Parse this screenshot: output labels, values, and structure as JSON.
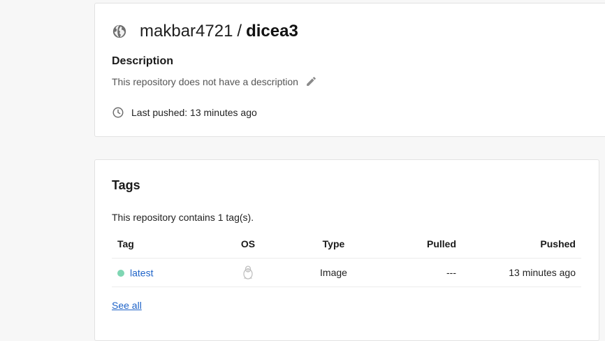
{
  "repo": {
    "owner": "makbar4721",
    "separator": "/",
    "name": "dicea3",
    "visibility_icon": "globe-icon",
    "description_heading": "Description",
    "description_text": "This repository does not have a description",
    "edit_icon": "pencil-icon",
    "last_pushed_icon": "clock-icon",
    "last_pushed_text": "Last pushed: 13 minutes ago"
  },
  "tags": {
    "heading": "Tags",
    "summary": "This repository contains 1 tag(s).",
    "columns": {
      "tag": "Tag",
      "os": "OS",
      "type": "Type",
      "pulled": "Pulled",
      "pushed": "Pushed"
    },
    "rows": [
      {
        "tag": "latest",
        "os_icon": "linux-icon",
        "type": "Image",
        "pulled": "---",
        "pushed": "13 minutes ago",
        "status_color": "#7fd6b3"
      }
    ],
    "see_all": "See all"
  },
  "colors": {
    "link": "#1e63c8",
    "background": "#f7f7f7",
    "card": "#ffffff",
    "tag_status": "#7fd6b3"
  }
}
